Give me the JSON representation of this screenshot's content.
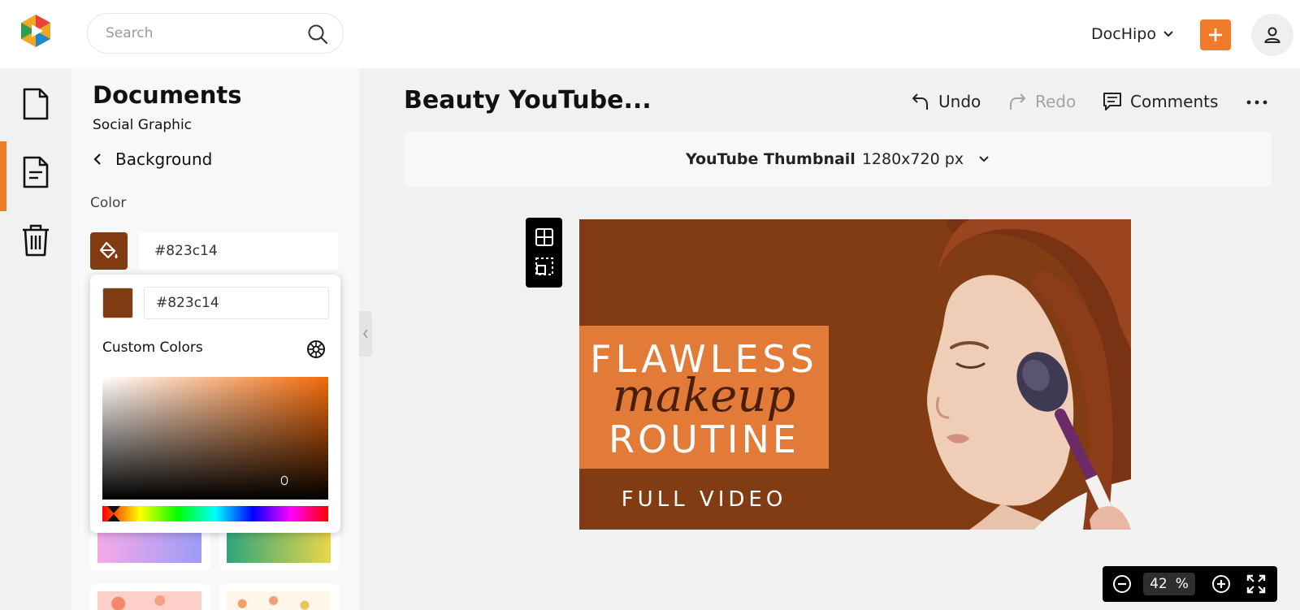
{
  "header": {
    "search_placeholder": "Search",
    "workspace_name": "DocHipo",
    "brand_color": "#f07b2a"
  },
  "rail": {
    "items": [
      "document-icon",
      "document-list-icon",
      "trash-icon"
    ],
    "active_index": 1
  },
  "panel": {
    "title": "Documents",
    "subtitle": "Social Graphic",
    "back_label": "Background",
    "color_label": "Color",
    "color_value": "#823c14"
  },
  "picker": {
    "hex_value": "#823c14",
    "custom_label": "Custom Colors"
  },
  "editor": {
    "doc_title": "Beauty YouTube...",
    "undo_label": "Undo",
    "redo_label": "Redo",
    "comments_label": "Comments",
    "format_name": "YouTube Thumbnail",
    "format_size": "1280x720 px"
  },
  "design": {
    "line1": "FLAWLESS",
    "line2": "makeup",
    "line3": "ROUTINE",
    "line4": "FULL VIDEO",
    "bg_color": "#823c14",
    "box_color": "#e27a38"
  },
  "zoom": {
    "value": "42",
    "unit": "%"
  }
}
